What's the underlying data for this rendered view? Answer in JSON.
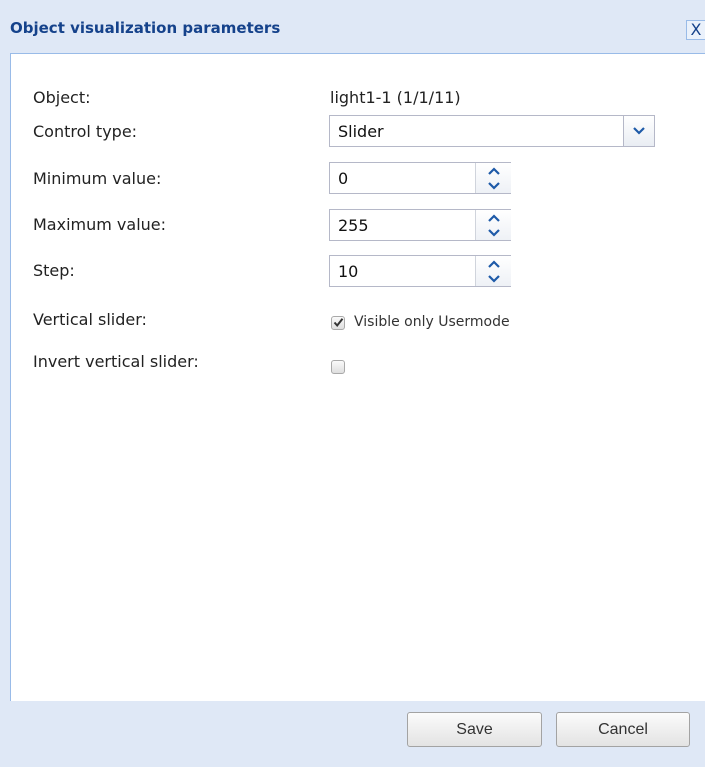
{
  "dialog": {
    "title": "Object visualization parameters",
    "close_label": "X"
  },
  "form": {
    "object_label": "Object:",
    "object_value": "light1-1 (1/1/11)",
    "control_type_label": "Control type:",
    "control_type_value": "Slider",
    "min_label": "Minimum value:",
    "min_value": "0",
    "max_label": "Maximum value:",
    "max_value": "255",
    "step_label": "Step:",
    "step_value": "10",
    "vertical_label": "Vertical slider:",
    "vertical_checked": true,
    "vertical_checkbox_label": "Visible only Usermode",
    "invert_label": "Invert vertical slider:",
    "invert_checked": false
  },
  "footer": {
    "save_label": "Save",
    "cancel_label": "Cancel"
  },
  "icons": {
    "dropdown": "chevron-down-icon",
    "spin_up": "chevron-up-icon",
    "spin_down": "chevron-down-icon",
    "check": "checkmark-icon"
  },
  "colors": {
    "title": "#15428b",
    "frame": "#dfe8f6",
    "border": "#99bbe8",
    "chevron": "#1e5aa8"
  }
}
